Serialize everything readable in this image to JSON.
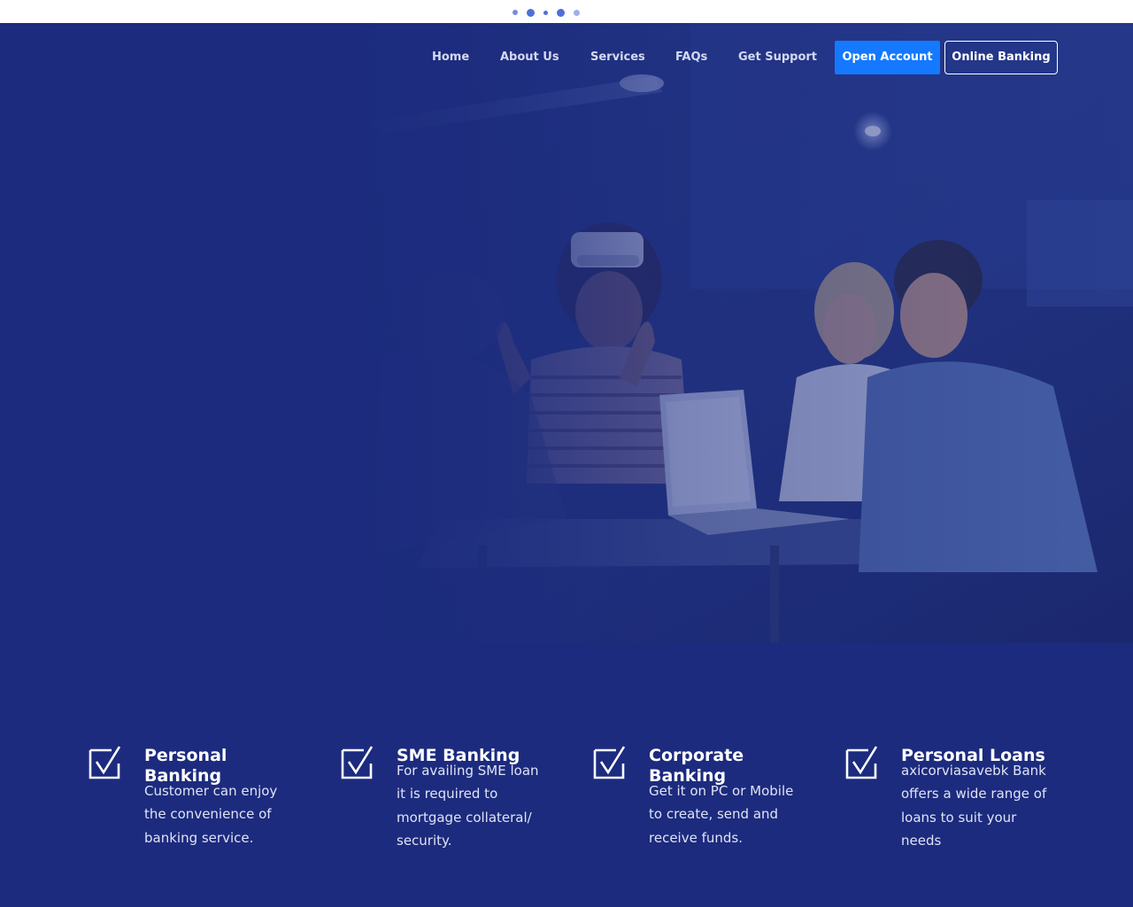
{
  "nav": {
    "home": "Home",
    "about": "About Us",
    "services": "Services",
    "faqs": "FAQs",
    "support": "Get Support",
    "open_account": "Open Account",
    "online_banking": "Online Banking"
  },
  "services": [
    {
      "title": "Personal Banking",
      "description": "Customer can enjoy the convenience of banking service.",
      "icon": "checkbox-icon"
    },
    {
      "title": "SME Banking",
      "description": "For availing SME loan it is required to mortgage collateral/ security.",
      "icon": "checkbox-icon"
    },
    {
      "title": "Corporate Banking",
      "description": "Get it on PC or Mobile to create, send and receive funds.",
      "icon": "checkbox-icon"
    },
    {
      "title": "Personal Loans",
      "description": "axicorviasavebk Bank offers a wide range of loans to suit your needs",
      "icon": "checkbox-icon"
    }
  ],
  "colors": {
    "primary_blue": "#1c2b7d",
    "button_blue": "#1479ff",
    "nav_text": "#d4d9f0",
    "white": "#ffffff"
  }
}
